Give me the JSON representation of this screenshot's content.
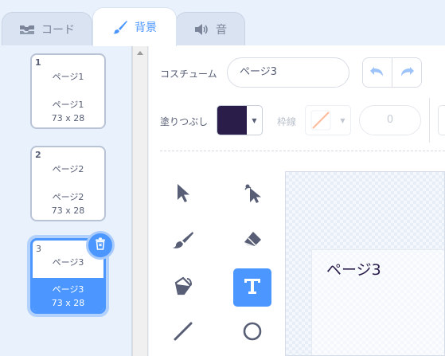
{
  "tabs": [
    {
      "label": "コード",
      "icon": "code-blocks-icon",
      "active": false
    },
    {
      "label": "背景",
      "icon": "paintbrush-icon",
      "active": true
    },
    {
      "label": "音",
      "icon": "speaker-icon",
      "active": false
    }
  ],
  "costumes": [
    {
      "number": "1",
      "name": "ページ1",
      "name_below": "ページ1",
      "size": "73 x 28",
      "selected": false
    },
    {
      "number": "2",
      "name": "ページ2",
      "name_below": "ページ2",
      "size": "73 x 28",
      "selected": false
    },
    {
      "number": "3",
      "name": "ページ3",
      "name_below": "ページ3",
      "size": "73 x 28",
      "selected": true
    }
  ],
  "editor": {
    "costume_label": "コスチューム",
    "costume_name": "ページ3",
    "fill_label": "塗りつぶし",
    "fill_color": "#2b1d4a",
    "outline_label": "枠線",
    "outline_width": "0",
    "canvas_text": "ページ3"
  },
  "tools": [
    {
      "name": "select-tool",
      "icon": "arrow-pointer-icon",
      "active": false
    },
    {
      "name": "reshape-tool",
      "icon": "reshape-pointer-icon",
      "active": false
    },
    {
      "name": "brush-tool",
      "icon": "brush-icon",
      "active": false
    },
    {
      "name": "eraser-tool",
      "icon": "eraser-icon",
      "active": false
    },
    {
      "name": "fill-tool",
      "icon": "paint-bucket-icon",
      "active": false
    },
    {
      "name": "text-tool",
      "icon": "text-t-icon",
      "active": true
    },
    {
      "name": "line-tool",
      "icon": "line-icon",
      "active": false
    },
    {
      "name": "circle-tool",
      "icon": "circle-icon",
      "active": false
    }
  ],
  "colors": {
    "accent": "#4c97ff",
    "text": "#575e75",
    "background": "#e9f1fc"
  }
}
